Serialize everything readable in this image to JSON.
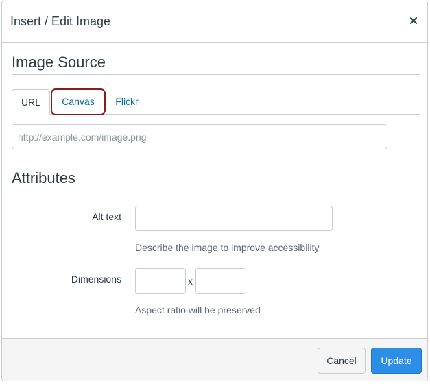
{
  "dialog": {
    "title": "Insert / Edit Image",
    "close_label": "×"
  },
  "image_source": {
    "heading": "Image Source",
    "tabs": [
      {
        "label": "URL",
        "active": true
      },
      {
        "label": "Canvas",
        "active": false,
        "highlighted": true
      },
      {
        "label": "Flickr",
        "active": false
      }
    ],
    "url_input": {
      "value": "",
      "placeholder": "http://example.com/image.png"
    }
  },
  "attributes": {
    "heading": "Attributes",
    "alt_text": {
      "label": "Alt text",
      "value": "",
      "hint": "Describe the image to improve accessibility"
    },
    "dimensions": {
      "label": "Dimensions",
      "width_value": "",
      "height_value": "",
      "separator": "x",
      "hint": "Aspect ratio will be preserved"
    }
  },
  "footer": {
    "cancel_label": "Cancel",
    "update_label": "Update"
  },
  "colors": {
    "link": "#0770a3",
    "primary_button": "#2d8ee6",
    "highlight_outline": "#8b1a1a",
    "border": "#c7cdd1"
  }
}
